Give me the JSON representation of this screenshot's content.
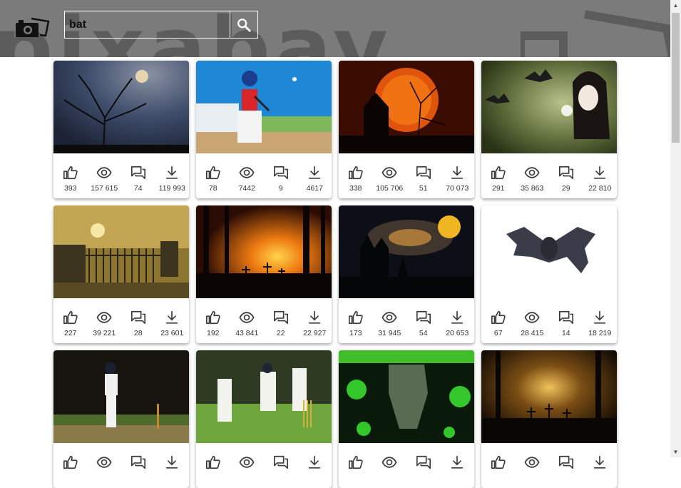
{
  "header": {
    "bg_word": "pixabay",
    "search": {
      "value": "bat",
      "placeholder": ""
    }
  },
  "colors": {
    "header_bg": "#7b7b7b",
    "icon": "#3a3a3a"
  },
  "cards": [
    {
      "likes": "393",
      "views": "157 615",
      "comments": "74",
      "downloads": "119 993",
      "scene": "tree-moon"
    },
    {
      "likes": "78",
      "views": "7442",
      "comments": "9",
      "downloads": "4617",
      "scene": "baseball"
    },
    {
      "likes": "338",
      "views": "105 706",
      "comments": "51",
      "downloads": "70 073",
      "scene": "orange-moon"
    },
    {
      "likes": "291",
      "views": "35 863",
      "comments": "29",
      "downloads": "22 810",
      "scene": "girl-bats"
    },
    {
      "likes": "227",
      "views": "39 221",
      "comments": "28",
      "downloads": "23 601",
      "scene": "graveyard"
    },
    {
      "likes": "192",
      "views": "43 841",
      "comments": "22",
      "downloads": "22 927",
      "scene": "forest-sunset"
    },
    {
      "likes": "173",
      "views": "31 945",
      "comments": "54",
      "downloads": "20 653",
      "scene": "night-castle"
    },
    {
      "likes": "67",
      "views": "28 415",
      "comments": "14",
      "downloads": "18 219",
      "scene": "bat"
    },
    {
      "likes": "",
      "views": "",
      "comments": "",
      "downloads": "",
      "scene": "cricket-batsman"
    },
    {
      "likes": "",
      "views": "",
      "comments": "",
      "downloads": "",
      "scene": "cricket-team"
    },
    {
      "likes": "",
      "views": "",
      "comments": "",
      "downloads": "",
      "scene": "virus-bat"
    },
    {
      "likes": "",
      "views": "",
      "comments": "",
      "downloads": "",
      "scene": "dark-graveyard"
    }
  ]
}
